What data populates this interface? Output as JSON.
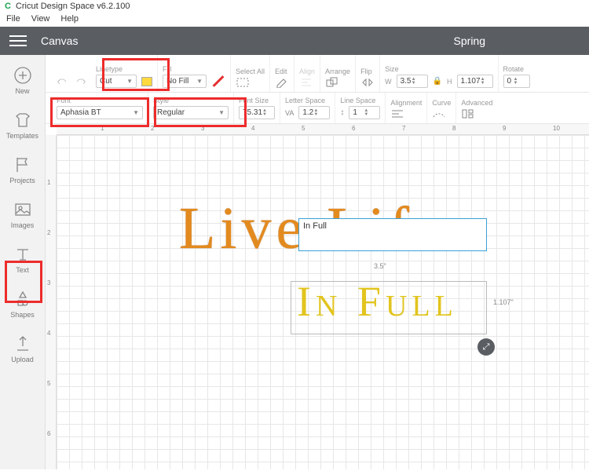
{
  "app": {
    "title": "Cricut Design Space  v6.2.100",
    "logo_letter": "C"
  },
  "menu": {
    "file": "File",
    "view": "View",
    "help": "Help"
  },
  "header": {
    "canvas": "Canvas",
    "project": "Spring"
  },
  "side": {
    "new": "New",
    "templates": "Templates",
    "projects": "Projects",
    "images": "Images",
    "text": "Text",
    "shapes": "Shapes",
    "upload": "Upload"
  },
  "toolbar1": {
    "linetype_label": "Linetype",
    "linetype_value": "Cut",
    "fill_label": "Fill",
    "fill_value": "No Fill",
    "selectall": "Select All",
    "edit": "Edit",
    "align": "Align",
    "arrange": "Arrange",
    "flip": "Flip",
    "size_label": "Size",
    "w_label": "W",
    "w_value": "3.5",
    "h_label": "H",
    "h_value": "1.107",
    "rotate_label": "Rotate",
    "rotate_value": "0"
  },
  "toolbar2": {
    "font_label": "Font",
    "font_value": "Aphasia BT",
    "style_label": "Style",
    "style_value": "Regular",
    "fontsize_label": "Font Size",
    "fontsize_value": "75.31",
    "letterspace_label": "Letter Space",
    "letterspace_value": "1.2",
    "linespace_label": "Line Space",
    "linespace_value": "1",
    "alignment_label": "Alignment",
    "curve_label": "Curve",
    "advanced_label": "Advanced"
  },
  "ruler": {
    "h": [
      "1",
      "2",
      "3",
      "4",
      "5",
      "6",
      "7",
      "8",
      "9",
      "10"
    ],
    "v": [
      "1",
      "2",
      "3",
      "4",
      "5",
      "6"
    ]
  },
  "canvas": {
    "text1": "Live Life",
    "text2": "In Full",
    "input_value": "In Full",
    "dim_x": "3.5\"",
    "dim_y": "1.107\""
  }
}
